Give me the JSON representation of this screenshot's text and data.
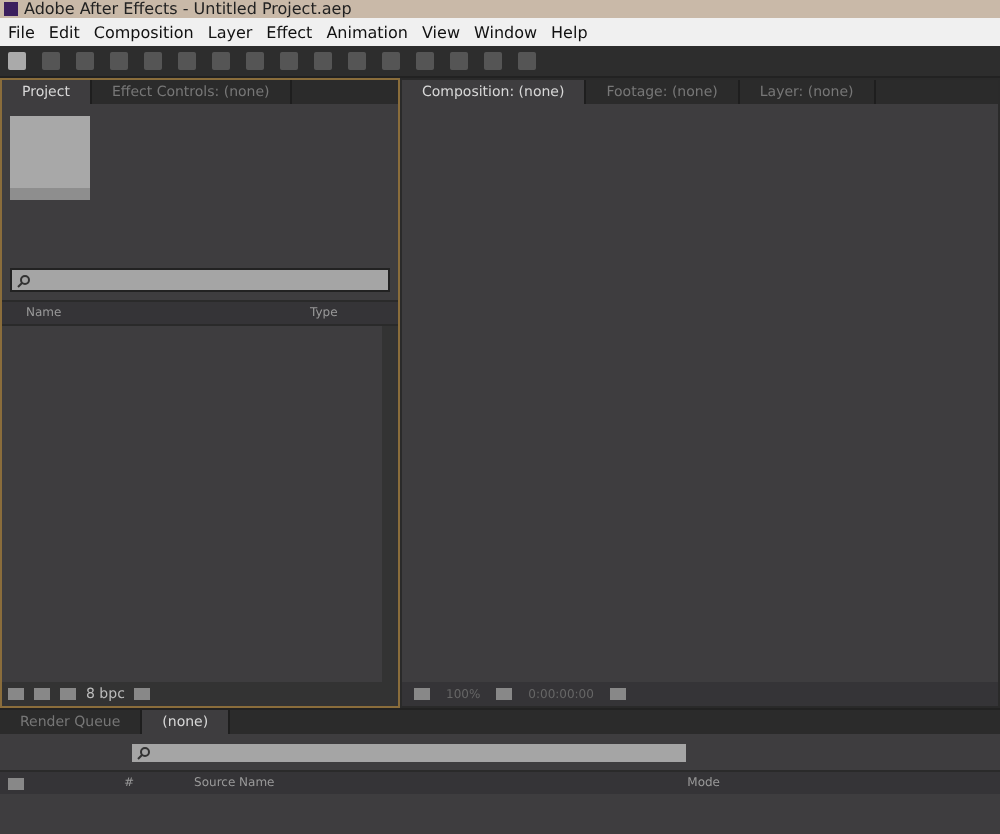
{
  "window": {
    "title": "Adobe After Effects - Untitled Project.aep"
  },
  "menu": [
    "File",
    "Edit",
    "Composition",
    "Layer",
    "Effect",
    "Animation",
    "View",
    "Window",
    "Help"
  ],
  "project_panel": {
    "tabs": [
      {
        "label": "Project",
        "selected": true
      },
      {
        "label": "Effect Controls: (none)",
        "selected": false
      }
    ],
    "columns": [
      "Name",
      "Type"
    ],
    "bit_depth": "8 bpc"
  },
  "composition_panel": {
    "tabs": [
      {
        "label": "Composition: (none)",
        "selected": true
      },
      {
        "label": "Footage: (none)",
        "selected": false
      },
      {
        "label": "Layer: (none)",
        "selected": false
      }
    ],
    "zoom": "100%",
    "timecode": "0:00:00:00"
  },
  "timeline_panel": {
    "tabs": [
      {
        "label": "Render Queue",
        "selected": false
      },
      {
        "label": "(none)",
        "selected": true
      }
    ],
    "columns": [
      "#",
      "Source Name",
      "Mode"
    ]
  }
}
